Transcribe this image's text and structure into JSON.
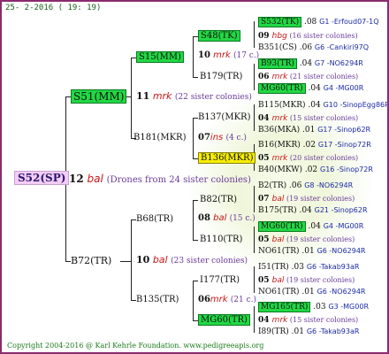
{
  "header": "25- 2-2016 ( 19: 19)",
  "footer": "Copyright 2004-2016 @ Karl Kehrle Foundation.   www.pedigreeapis.org",
  "root": {
    "name": "S52(SP)",
    "num": "12",
    "mark": "bal",
    "note": "(Drones from 24 sister colonies)"
  },
  "s51": {
    "name": "S51(MM)",
    "num": "11",
    "mark": "mrk",
    "note": "(22 sister colonies)"
  },
  "b72": {
    "name": "B72(TR)",
    "num": "10",
    "mark": "bal",
    "note": "(23 sister colonies)"
  },
  "s15": {
    "name": "S15(MM)"
  },
  "b181": {
    "name": "B181(MKR)"
  },
  "b68": {
    "name": "B68(TR)"
  },
  "b135": {
    "name": "B135(TR)"
  },
  "s48": {
    "name": "S48(TK)",
    "num": "10",
    "mark": "mrk",
    "note": "(17 c.)"
  },
  "b179": {
    "name": "B179(TR)"
  },
  "b137": {
    "name": "B137(MKR)",
    "num": "07",
    "mark": "ins",
    "note": "(4 c.)"
  },
  "b136": {
    "name": "B136(MKR)"
  },
  "b82": {
    "name": "B82(TR)",
    "num": "08",
    "mark": "bal",
    "note": "(15 c.)"
  },
  "b110": {
    "name": "B110(TR)"
  },
  "i177": {
    "name": "I177(TR)",
    "num": "06",
    "mark": "mrk",
    "note": "(21 c.)"
  },
  "mg60": {
    "name": "MG60(TR)"
  },
  "leaves": [
    {
      "name": "S532(TK)",
      "v": ".08",
      "code": "G1 -Erfoud07-1Q",
      "hl": "g"
    },
    {
      "num": "09",
      "mark": "hbg",
      "note": "(16 sister colonies)"
    },
    {
      "name": "B351(CS)",
      "v": ".06",
      "code": "G6 -Cankiri97Q"
    },
    {
      "name": "B93(TR)",
      "v": ".04",
      "code": "G7 -NO6294R",
      "hl": "g"
    },
    {
      "num": "06",
      "mark": "mrk",
      "note": "(21 sister colonies)"
    },
    {
      "name": "MG60(TR)",
      "v": ".04",
      "code": "G4 -MG00R",
      "hl": "g"
    },
    {
      "name": "B115(MKR)",
      "v": ".04",
      "code": "G10 -SinopEgg86R"
    },
    {
      "num": "04",
      "mark": "mrk",
      "note": "(15 sister colonies)"
    },
    {
      "name": "B36(MKA)",
      "v": ".01",
      "code": "G17 -Sinop62R"
    },
    {
      "name": "B16(MKR)",
      "v": ".02",
      "code": "G17 -Sinop72R"
    },
    {
      "num": "05",
      "mark": "mrk",
      "note": "(20 sister colonies)"
    },
    {
      "name": "B40(MKW)",
      "v": ".02",
      "code": "G16 -Sinop72R"
    },
    {
      "name": "B2(TR)",
      "v": ".06",
      "code": "G8 -NO6294R"
    },
    {
      "num": "07",
      "mark": "bal",
      "note": "(19 sister colonies)"
    },
    {
      "name": "B175(TR)",
      "v": ".04",
      "code": "G21 -Sinop62R"
    },
    {
      "name": "MG60(TR)",
      "v": ".04",
      "code": "G4 -MG00R",
      "hl": "g"
    },
    {
      "num": "05",
      "mark": "bal",
      "note": "(19 sister colonies)"
    },
    {
      "name": "NO61(TR)",
      "v": ".01",
      "code": "G6 -NO6294R"
    },
    {
      "name": "I51(TR)",
      "v": ".03",
      "code": "G6 -Takab93aR"
    },
    {
      "num": "05",
      "mark": "bal",
      "note": "(19 sister colonies)"
    },
    {
      "name": "NO61(TR)",
      "v": ".01",
      "code": "G6 -NO6294R"
    },
    {
      "name": "MG165(TR)",
      "v": ".03",
      "code": "G3 -MG00R",
      "hl": "g"
    },
    {
      "num": "04",
      "mark": "mrk",
      "note": "(15 sister colonies)"
    },
    {
      "name": "I89(TR)",
      "v": ".01",
      "code": "G6 -Takab93aR"
    }
  ]
}
